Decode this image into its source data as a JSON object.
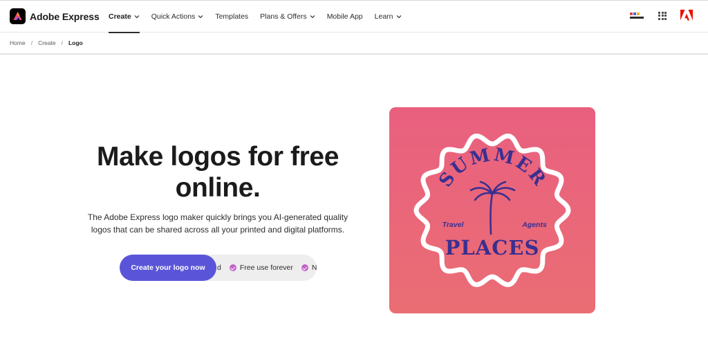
{
  "brand": {
    "name": "Adobe Express"
  },
  "nav": {
    "items": [
      {
        "label": "Create",
        "dropdown": true,
        "active": true
      },
      {
        "label": "Quick Actions",
        "dropdown": true
      },
      {
        "label": "Templates",
        "dropdown": false
      },
      {
        "label": "Plans & Offers",
        "dropdown": true
      },
      {
        "label": "Mobile App",
        "dropdown": false
      },
      {
        "label": "Learn",
        "dropdown": true
      }
    ],
    "icons": [
      "profile-thumbnail",
      "apps-grid-icon",
      "adobe-icon"
    ]
  },
  "breadcrumb": {
    "items": [
      "Home",
      "Create",
      "Logo"
    ],
    "separator": "/"
  },
  "hero": {
    "title_line1": "Make logos for free",
    "title_line2": "online.",
    "description_line1": "The Adobe Express logo maker quickly brings you AI-generated quality",
    "description_line2": "logos that can be shared across all your printed and digital platforms.",
    "cta_label": "Create your logo now",
    "features": [
      "d",
      "Free use forever",
      "N"
    ]
  },
  "logo_preview": {
    "top_text": "SUMMER",
    "left_text": "Travel",
    "right_text": "Agents",
    "bottom_text": "PLACES"
  },
  "colors": {
    "cta": "#5a55d8",
    "check": "#c462c9",
    "card_pink": "#e9607f",
    "logo_ink": "#3a2f8f"
  }
}
